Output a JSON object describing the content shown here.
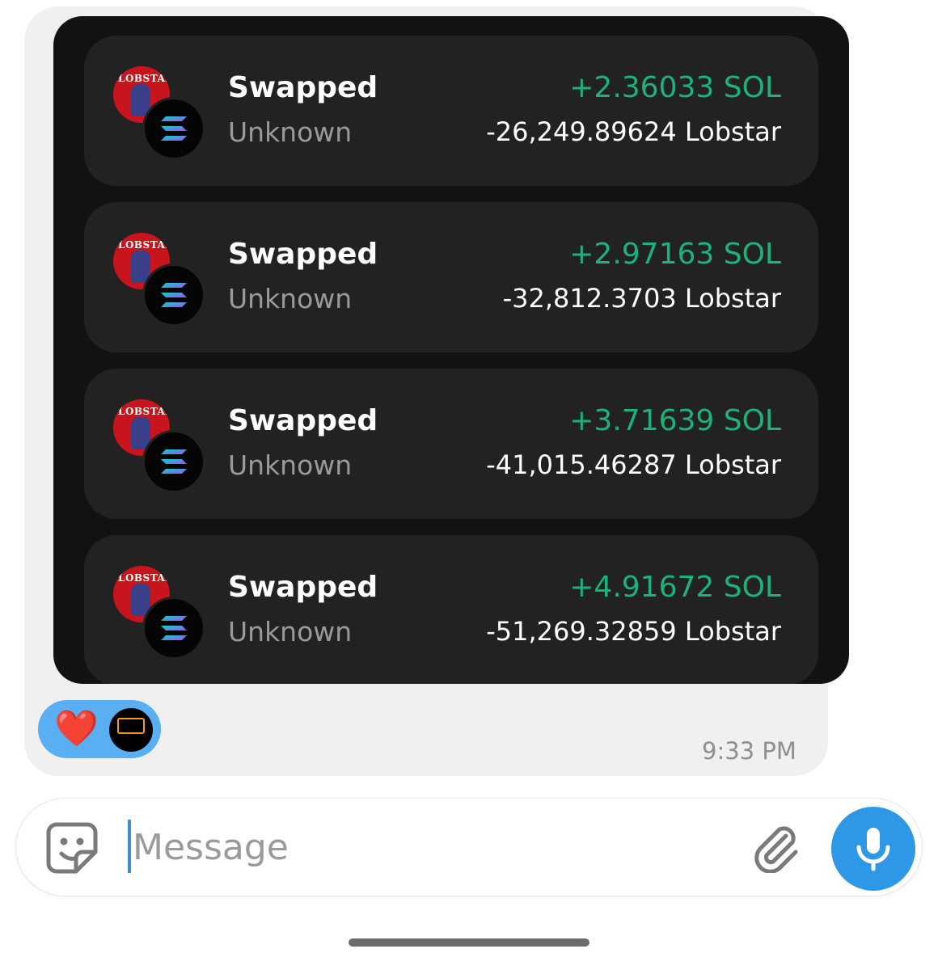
{
  "message": {
    "transactions": [
      {
        "title": "Swapped",
        "subtitle": "Unknown",
        "sol_amount": "+2.36033 SOL",
        "token_amount": "-26,249.89624 Lobstar",
        "token_logo_text": "LOBSTAR"
      },
      {
        "title": "Swapped",
        "subtitle": "Unknown",
        "sol_amount": "+2.97163 SOL",
        "token_amount": "-32,812.3703 Lobstar",
        "token_logo_text": "LOBSTAR"
      },
      {
        "title": "Swapped",
        "subtitle": "Unknown",
        "sol_amount": "+3.71639 SOL",
        "token_amount": "-41,015.46287 Lobstar",
        "token_logo_text": "LOBSTAR"
      },
      {
        "title": "Swapped",
        "subtitle": "Unknown",
        "sol_amount": "+4.91672 SOL",
        "token_amount": "-51,269.32859 Lobstar",
        "token_logo_text": "LOBSTAR"
      }
    ],
    "reaction": {
      "emoji": "❤️",
      "icon": "heart-icon"
    },
    "time": "9:33 PM"
  },
  "composer": {
    "placeholder": "Message",
    "sticker_icon": "sticker-icon",
    "attach_icon": "paperclip-icon",
    "mic_icon": "microphone-icon"
  },
  "colors": {
    "positive": "#1cb27a",
    "accent": "#2e97e6",
    "reaction_bg": "#5aaef2",
    "card_bg": "#222222",
    "panel_bg": "#121212"
  }
}
